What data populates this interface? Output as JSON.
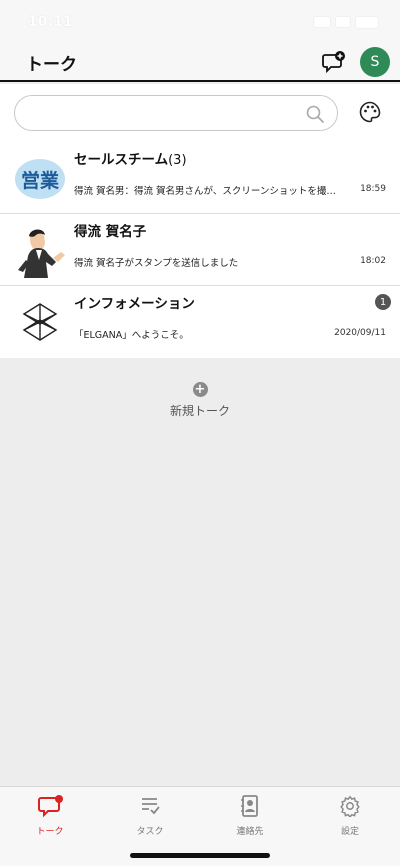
{
  "status_bar": {
    "time": "10:11"
  },
  "header": {
    "title": "トーク",
    "avatar_initial": "S"
  },
  "search": {
    "value": "",
    "placeholder": ""
  },
  "talks": [
    {
      "name": "セールスチーム",
      "count": "(3)",
      "preview": "得流 賀名男：得流 賀名男さんが、スクリーンショットを撮…",
      "time": "18:59",
      "badge": "",
      "thumb": "eigyo-icon"
    },
    {
      "name": "得流 賀名子",
      "count": "",
      "preview": "得流 賀名子がスタンプを送信しました",
      "time": "18:02",
      "badge": "",
      "thumb": "person-photo"
    },
    {
      "name": "インフォメーション",
      "count": "",
      "preview": "「ELGANA」へようこそ。",
      "time": "2020/09/11",
      "badge": "1",
      "thumb": "elgana-logo"
    }
  ],
  "new_talk": {
    "label": "新規トーク"
  },
  "tabs": [
    {
      "label": "トーク",
      "icon": "chat-icon",
      "active": true
    },
    {
      "label": "タスク",
      "icon": "task-icon",
      "active": false
    },
    {
      "label": "連絡先",
      "icon": "contacts-icon",
      "active": false
    },
    {
      "label": "設定",
      "icon": "gear-icon",
      "active": false
    }
  ],
  "eigyo_text": "営業",
  "colors": {
    "accent": "#d22222",
    "avatar": "#2e8b57",
    "eigyo_bg": "#bfe0f2",
    "eigyo_text": "#1d5a9a"
  }
}
